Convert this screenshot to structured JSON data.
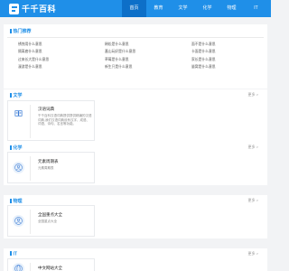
{
  "header": {
    "brand": "千千百科",
    "nav": [
      "首页",
      "教育",
      "文学",
      "化学",
      "物理",
      "IT"
    ]
  },
  "hot": {
    "title": "热门推荐",
    "links": [
      "锈蚀用什么意思",
      "稀松是什么意思",
      "面不是什么意思",
      "隔离套什么意思",
      "蓋山玩好是什么意思",
      "卡面是什么意思",
      "过来长大是什么意思",
      "草莓是什么意思",
      "家长是什么意思",
      "漫游是什么意思",
      "新生只是什么意思",
      "量窝是什么意思"
    ]
  },
  "sections": [
    {
      "title": "文学",
      "more": "更多 >",
      "item": {
        "name": "汉语词典",
        "desc": "千千百科汉语词典提供提供精编的汉语词典,我们汉语词典设有汉字、成语、词语、诗句、名言等功能。"
      }
    },
    {
      "title": "化学",
      "more": "更多 >",
      "item": {
        "name": "元素周期表",
        "desc": "元素周期表"
      }
    },
    {
      "title": "物理",
      "more": "更多 >",
      "item": {
        "name": "全国重点大全",
        "desc": "全国重点大全"
      }
    },
    {
      "title": "IT",
      "more": "更多 >",
      "item": {
        "name": "中文网站大全",
        "desc": ""
      }
    }
  ]
}
